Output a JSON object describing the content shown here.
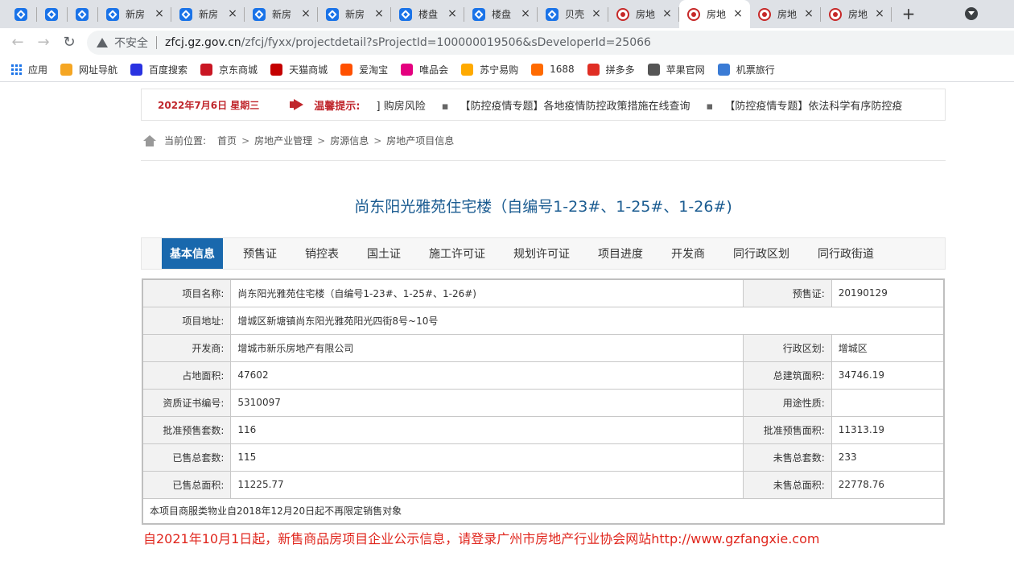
{
  "browser": {
    "tabs": [
      {
        "title": "",
        "icon": "hex-icon",
        "active": false,
        "closable": false
      },
      {
        "title": "",
        "icon": "hex-icon",
        "active": false,
        "closable": false
      },
      {
        "title": "",
        "icon": "hex-icon",
        "active": false,
        "closable": false
      },
      {
        "title": "新房",
        "icon": "hex-icon",
        "active": false,
        "closable": true
      },
      {
        "title": "新房",
        "icon": "hex-icon",
        "active": false,
        "closable": true
      },
      {
        "title": "新房",
        "icon": "hex-icon",
        "active": false,
        "closable": true
      },
      {
        "title": "新房",
        "icon": "hex-icon",
        "active": false,
        "closable": true
      },
      {
        "title": "楼盘",
        "icon": "hex-icon",
        "active": false,
        "closable": true
      },
      {
        "title": "楼盘",
        "icon": "hex-icon",
        "active": false,
        "closable": true
      },
      {
        "title": "贝壳",
        "icon": "hex-icon",
        "active": false,
        "closable": true
      },
      {
        "title": "房地",
        "icon": "seal-icon",
        "active": false,
        "closable": true
      },
      {
        "title": "房地",
        "icon": "seal-icon",
        "active": true,
        "closable": true
      },
      {
        "title": "房地",
        "icon": "seal-icon",
        "active": false,
        "closable": true
      },
      {
        "title": "房地",
        "icon": "seal-icon",
        "active": false,
        "closable": true
      }
    ],
    "new_tab": "+",
    "insecure_label": "不安全",
    "url_host": "zfcj.gz.gov.cn",
    "url_path": "/zfcj/fyxx/projectdetail?sProjectId=100000019506&sDeveloperId=25066",
    "bookmarks": [
      {
        "label": "应用",
        "icon": "apps-grid-icon",
        "color": "#1a73e8"
      },
      {
        "label": "网址导航",
        "icon": "nav-icon",
        "color": "#f5a623"
      },
      {
        "label": "百度搜索",
        "icon": "baidu-icon",
        "color": "#2932e1"
      },
      {
        "label": "京东商城",
        "icon": "jd-icon",
        "color": "#c91623"
      },
      {
        "label": "天猫商城",
        "icon": "tmall-icon",
        "color": "#c40000"
      },
      {
        "label": "爱淘宝",
        "icon": "taobao-icon",
        "color": "#ff5000"
      },
      {
        "label": "唯品会",
        "icon": "vip-icon",
        "color": "#e4007f"
      },
      {
        "label": "苏宁易购",
        "icon": "suning-icon",
        "color": "#ffaa00"
      },
      {
        "label": "1688",
        "icon": "alibaba-icon",
        "color": "#ff6a00"
      },
      {
        "label": "拼多多",
        "icon": "pdd-icon",
        "color": "#e02e24"
      },
      {
        "label": "苹果官网",
        "icon": "apple-icon",
        "color": "#555555"
      },
      {
        "label": "机票旅行",
        "icon": "travel-icon",
        "color": "#3a7bd5"
      }
    ]
  },
  "notice": {
    "date": "2022年7月6日 星期三",
    "label": "温馨提示:",
    "items": [
      "] 购房风险",
      "【防控疫情专题】各地疫情防控政策措施在线查询",
      "【防控疫情专题】依法科学有序防控疫"
    ]
  },
  "breadcrumb": {
    "prefix": "当前位置:",
    "items": [
      "首页",
      "房地产业管理",
      "房源信息",
      "房地产项目信息"
    ],
    "sep": ">"
  },
  "title": "尚东阳光雅苑住宅楼（自编号1-23#、1-25#、1-26#)",
  "tabs": [
    "基本信息",
    "预售证",
    "销控表",
    "国土证",
    "施工许可证",
    "规划许可证",
    "项目进度",
    "开发商",
    "同行政区划",
    "同行政街道"
  ],
  "info": {
    "name_label": "项目名称:",
    "name": "尚东阳光雅苑住宅楼（自编号1-23#、1-25#、1-26#)",
    "presale_label": "预售证:",
    "presale": "20190129",
    "address_label": "项目地址:",
    "address": "增城区新塘镇尚东阳光雅苑阳光四街8号~10号",
    "developer_label": "开发商:",
    "developer": "增城市新乐房地产有限公司",
    "district_label": "行政区划:",
    "district": "增城区",
    "land_area_label": "占地面积:",
    "land_area": "47602",
    "build_area_label": "总建筑面积:",
    "build_area": "34746.19",
    "cert_label": "资质证书编号:",
    "cert": "5310097",
    "usage_label": "用途性质:",
    "usage": "",
    "approved_units_label": "批准预售套数:",
    "approved_units": "116",
    "approved_area_label": "批准预售面积:",
    "approved_area": "11313.19",
    "sold_units_label": "已售总套数:",
    "sold_units": "115",
    "unsold_units_label": "未售总套数:",
    "unsold_units": "233",
    "sold_area_label": "已售总面积:",
    "sold_area": "11225.77",
    "unsold_area_label": "未售总面积:",
    "unsold_area": "22778.76",
    "note": "本项目商服类物业自2018年12月20日起不再限定销售对象"
  },
  "footer_note": "自2021年10月1日起，新售商品房项目企业公示信息，请登录广州市房地产行业协会网站http://www.gzfangxie.com"
}
